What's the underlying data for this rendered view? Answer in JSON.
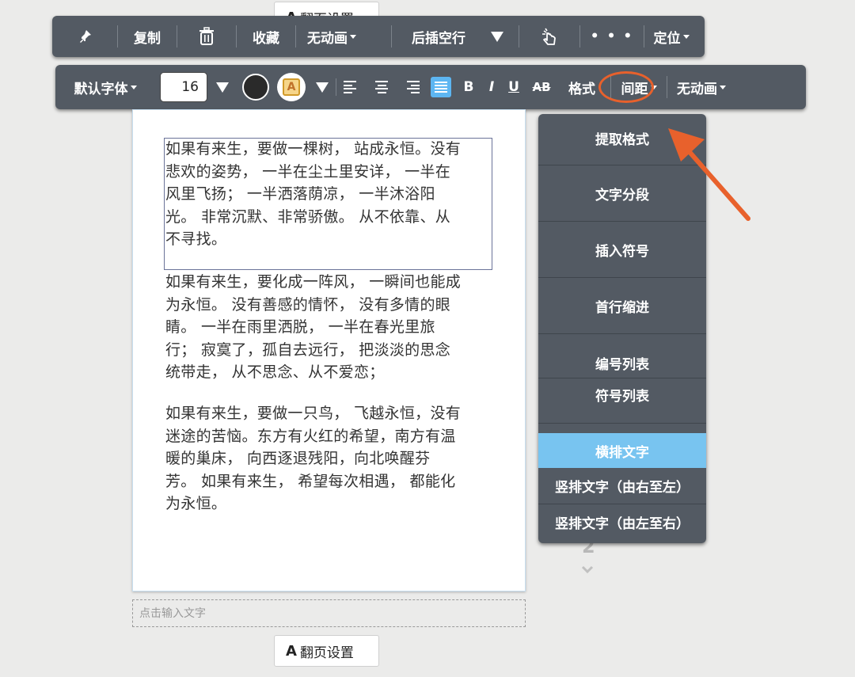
{
  "page_buttons": {
    "top_label": "翻页设置",
    "bottom_label": "翻页设置",
    "icon": "page-turn-icon"
  },
  "toolbar1": {
    "pin_icon": "pin-icon",
    "copy": "复制",
    "delete_icon": "trash-icon",
    "favorite": "收藏",
    "animation": "无动画",
    "insert_empty_line": "后插空行",
    "gesture_icon": "tap-hand-icon",
    "more": "• • •",
    "locate": "定位"
  },
  "toolbar2": {
    "font": "默认字体",
    "font_size": "16",
    "text_color": "#2a2a2a",
    "bg_color_letter": "A",
    "bold": "B",
    "italic": "I",
    "underline": "U",
    "strike": "AB",
    "format": "格式",
    "spacing": "间距",
    "animation": "无动画"
  },
  "document": {
    "selected_paragraph": [
      "如果有来生，要做一棵树， 站成永恒。没有",
      "悲欢的姿势， 一半在尘土里安详， 一半在",
      "风里飞扬； 一半洒落荫凉， 一半沐浴阳",
      "光。 非常沉默、非常骄傲。 从不依靠、从",
      "不寻找。"
    ],
    "paragraph2": [
      "如果有来生，要化成一阵风， 一瞬间也能成",
      "为永恒。 没有善感的情怀， 没有多情的眼",
      "睛。 一半在雨里洒脱， 一半在春光里旅",
      "行； 寂寞了，孤自去远行， 把淡淡的思念",
      "统带走， 从不思念、从不爱恋；"
    ],
    "paragraph3": [
      "如果有来生，要做一只鸟， 飞越永恒，没有",
      "迷途的苦恼。东方有火红的希望，南方有温",
      "暖的巢床， 向西逐退残阳，向北唤醒芬",
      "芳。 如果有来生， 希望每次相遇， 都能化",
      "为永恒。"
    ],
    "input_placeholder": "点击输入文字",
    "page_number": "2"
  },
  "context_menu": {
    "items": [
      "提取格式",
      "文字分段",
      "插入符号",
      "首行缩进",
      "编号列表",
      "符号列表",
      "横排文字",
      "竖排文字（由右至左）",
      "竖排文字（由左至右）"
    ],
    "active_item": "横排文字"
  },
  "colors": {
    "toolbar_bg": "#535a63",
    "accent_blue": "#5db6f2",
    "annotation_orange": "#e8612c"
  }
}
